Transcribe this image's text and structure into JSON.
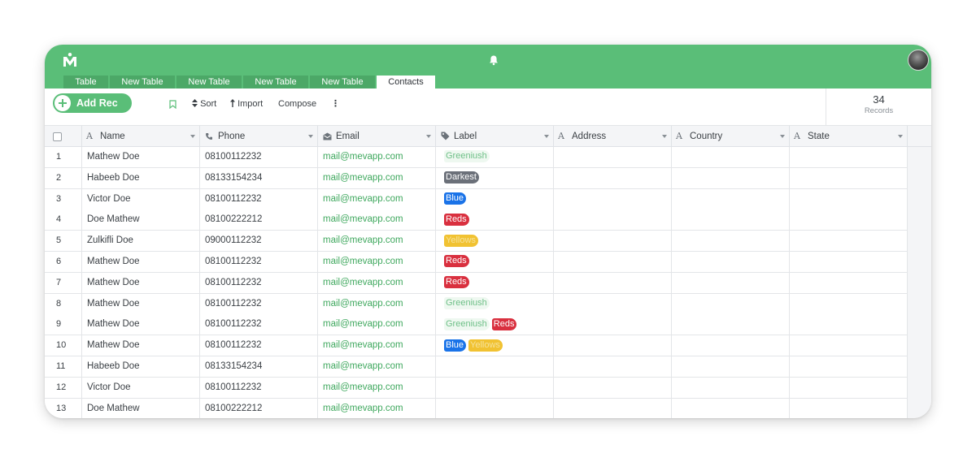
{
  "app": {
    "logo_letter": "M",
    "accent": "#5abe78",
    "tabs": [
      "Table",
      "New Table",
      "New Table",
      "New Table",
      "New Table",
      "Contacts"
    ],
    "active_tab": "Contacts"
  },
  "toolbar": {
    "add_label": "Add Rec",
    "sort_label": "Sort",
    "import_label": "Import",
    "compose_label": "Compose",
    "more_label": "⋮",
    "records_count": "34",
    "records_label": "Records"
  },
  "columns": {
    "name": "Name",
    "phone": "Phone",
    "email": "Email",
    "label": "Label",
    "address": "Address",
    "country": "Country",
    "state": "State"
  },
  "label_colors": {
    "Greeniush": "#6fc088",
    "Darkest": "#6b7079",
    "Blue": "#1a73e8",
    "Reds": "#d9303f",
    "Yellows": "#f1c232"
  },
  "rows": [
    {
      "num": "1",
      "name": "Mathew Doe",
      "phone": "08100112232",
      "email": "mail@mevapp.com",
      "labels": [
        "Greeniush"
      ]
    },
    {
      "num": "2",
      "name": "Habeeb Doe",
      "phone": "08133154234",
      "email": "mail@mevapp.com",
      "labels": [
        "Darkest"
      ]
    },
    {
      "num": "3",
      "name": "Victor Doe",
      "phone": "08100112232",
      "email": "mail@mevapp.com",
      "labels": [
        "Blue"
      ]
    },
    {
      "num": "4",
      "name": "Doe Mathew",
      "phone": "08100222212",
      "email": "mail@mevapp.com",
      "labels": [
        "Reds"
      ]
    },
    {
      "num": "5",
      "name": "Zulkifli Doe",
      "phone": "09000112232",
      "email": "mail@mevapp.com",
      "labels": [
        "Yellows"
      ]
    },
    {
      "num": "6",
      "name": "Mathew Doe",
      "phone": "08100112232",
      "email": "mail@mevapp.com",
      "labels": [
        "Reds"
      ]
    },
    {
      "num": "7",
      "name": "Mathew Doe",
      "phone": "08100112232",
      "email": "mail@mevapp.com",
      "labels": [
        "Reds"
      ]
    },
    {
      "num": "8",
      "name": "Mathew Doe",
      "phone": "08100112232",
      "email": "mail@mevapp.com",
      "labels": [
        "Greeniush"
      ]
    },
    {
      "num": "9",
      "name": "Mathew Doe",
      "phone": "08100112232",
      "email": "mail@mevapp.com",
      "labels": [
        "Greeniush",
        "Reds"
      ]
    },
    {
      "num": "10",
      "name": "Mathew Doe",
      "phone": "08100112232",
      "email": "mail@mevapp.com",
      "labels": [
        "Blue",
        "Yellows"
      ]
    },
    {
      "num": "11",
      "name": "Habeeb Doe",
      "phone": "08133154234",
      "email": "mail@mevapp.com",
      "labels": []
    },
    {
      "num": "12",
      "name": "Victor Doe",
      "phone": "08100112232",
      "email": "mail@mevapp.com",
      "labels": []
    },
    {
      "num": "13",
      "name": "Doe Mathew",
      "phone": "08100222212",
      "email": "mail@mevapp.com",
      "labels": []
    }
  ]
}
